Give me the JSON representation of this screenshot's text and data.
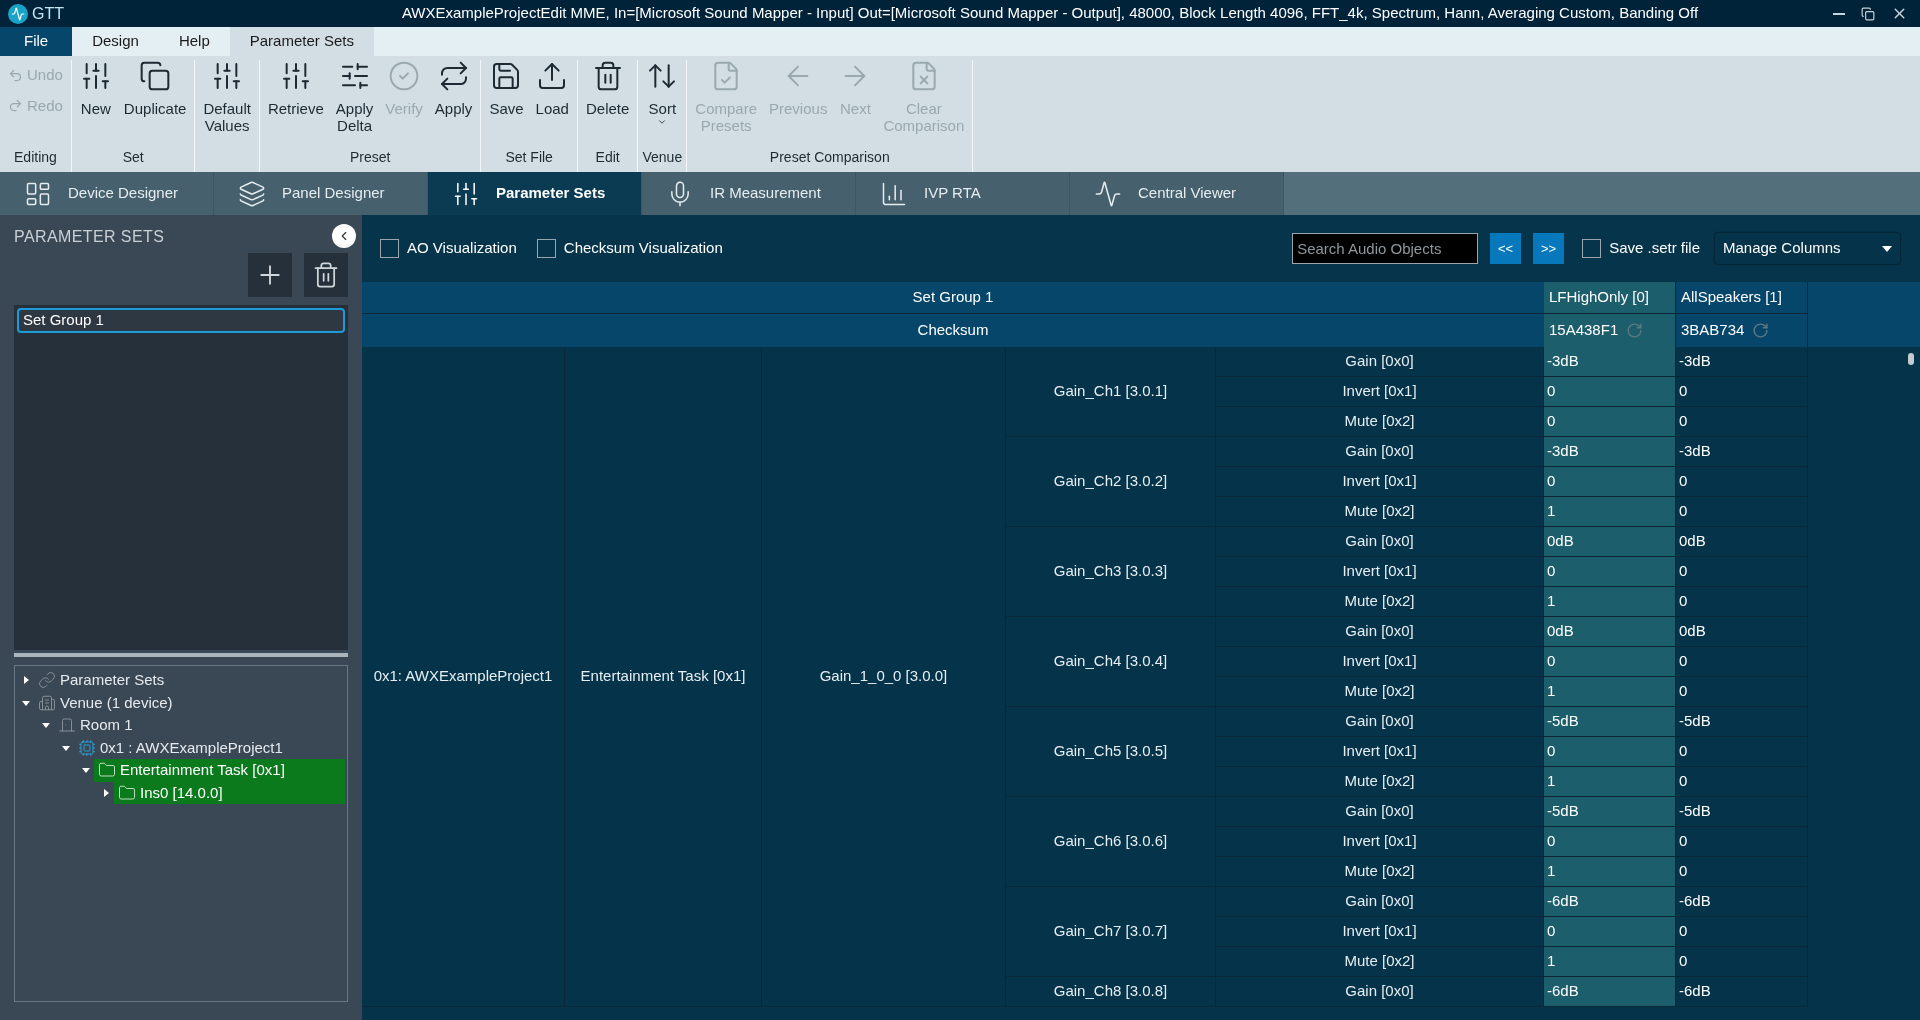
{
  "window": {
    "app_name": "GTT",
    "title": "AWXExampleProjectEdit MME, In=[Microsoft Sound Mapper - Input] Out=[Microsoft Sound Mapper - Output], 48000, Block Length 4096, FFT_4k, Spectrum, Hann, Averaging Custom, Banding Off"
  },
  "menu_tabs": [
    {
      "label": "File",
      "kind": "file",
      "selected": false
    },
    {
      "label": "Design",
      "kind": "tab",
      "selected": false
    },
    {
      "label": "Help",
      "kind": "tab",
      "selected": false
    },
    {
      "label": "Parameter Sets",
      "kind": "tab",
      "selected": true
    }
  ],
  "ribbon_groups": [
    {
      "label": "Editing",
      "kind": "small",
      "items": [
        {
          "label": "Undo",
          "disabled": true
        },
        {
          "label": "Redo",
          "disabled": true
        }
      ]
    },
    {
      "label": "Set",
      "kind": "large",
      "items": [
        {
          "label": "New",
          "disabled": false
        },
        {
          "label": "Duplicate",
          "disabled": false
        }
      ]
    },
    {
      "kind": "large",
      "items": [
        {
          "label": "Default\nValues",
          "disabled": false
        }
      ]
    },
    {
      "label": "Preset",
      "kind": "large",
      "items": [
        {
          "label": "Retrieve",
          "disabled": false
        },
        {
          "label": "Apply\nDelta",
          "disabled": false
        },
        {
          "label": "Verify",
          "disabled": true
        },
        {
          "label": "Apply",
          "disabled": false
        }
      ]
    },
    {
      "label": "Set File",
      "kind": "large",
      "items": [
        {
          "label": "Save",
          "disabled": false
        },
        {
          "label": "Load",
          "disabled": false
        }
      ]
    },
    {
      "label": "Edit",
      "kind": "large",
      "items": [
        {
          "label": "Delete",
          "disabled": false
        }
      ]
    },
    {
      "label": "Venue",
      "kind": "large",
      "items": [
        {
          "label": "Sort",
          "disabled": false,
          "menu": true
        }
      ]
    },
    {
      "label": "Preset Comparison",
      "kind": "large",
      "items": [
        {
          "label": "Compare\nPresets",
          "disabled": true
        },
        {
          "label": "Previous",
          "disabled": true
        },
        {
          "label": "Next",
          "disabled": true
        },
        {
          "label": "Clear\nComparison",
          "disabled": true
        }
      ]
    }
  ],
  "module_tabs": [
    {
      "label": "Device Designer",
      "selected": false
    },
    {
      "label": "Panel Designer",
      "selected": false
    },
    {
      "label": "Parameter Sets",
      "selected": true
    },
    {
      "label": "IR Measurement",
      "selected": false
    },
    {
      "label": "IVP RTA",
      "selected": false
    },
    {
      "label": "Central Viewer",
      "selected": false
    }
  ],
  "panel": {
    "title": "PARAMETER SETS",
    "set_groups": [
      {
        "label": "Set Group 1",
        "selected": true
      }
    ],
    "tree": [
      {
        "label": "Parameter Sets",
        "kind": "link",
        "expanded": false,
        "selected": false
      },
      {
        "label": "Venue (1 device)",
        "kind": "venue",
        "expanded": true,
        "selected": false,
        "children": [
          {
            "label": "Room 1",
            "kind": "room",
            "expanded": true,
            "selected": false,
            "children": [
              {
                "label": "0x1 : AWXExampleProject1",
                "kind": "device",
                "expanded": true,
                "selected": false,
                "children": [
                  {
                    "label": "Entertainment Task [0x1]",
                    "kind": "folder",
                    "expanded": true,
                    "selected": true,
                    "children": [
                      {
                        "label": "Ins0 [14.0.0]",
                        "kind": "folder",
                        "expanded": false,
                        "selected": true
                      }
                    ]
                  }
                ]
              }
            ]
          }
        ]
      }
    ]
  },
  "toolbar": {
    "checkboxes": [
      {
        "label": "AO Visualization",
        "checked": false
      },
      {
        "label": "Checksum Visualization",
        "checked": false
      }
    ],
    "search": {
      "placeholder": "Search Audio Objects"
    },
    "nav_buttons": [
      "<<",
      ">>"
    ],
    "save_option": {
      "label": "Save .setr file",
      "checked": false
    },
    "columns_dropdown": {
      "value": "Manage Columns"
    }
  },
  "grid": {
    "group_header": "Set Group 1",
    "checksum_label": "Checksum",
    "presets": [
      {
        "name": "LFHighOnly [0]",
        "checksum": "15A438F1",
        "selected": true
      },
      {
        "name": "AllSpeakers [1]",
        "checksum": "3BAB734",
        "selected": false
      }
    ],
    "device": "0x1: AWXExampleProject1",
    "task": "Entertainment Task [0x1]",
    "object": "Gain_1_0_0 [3.0.0]",
    "channels": [
      {
        "name": "Gain_Ch1 [3.0.1]",
        "params": [
          {
            "name": "Gain [0x0]",
            "values": [
              "-3dB",
              "-3dB"
            ]
          },
          {
            "name": "Invert [0x1]",
            "values": [
              "0",
              "0"
            ]
          },
          {
            "name": "Mute [0x2]",
            "values": [
              "0",
              "0"
            ]
          }
        ]
      },
      {
        "name": "Gain_Ch2 [3.0.2]",
        "params": [
          {
            "name": "Gain [0x0]",
            "values": [
              "-3dB",
              "-3dB"
            ]
          },
          {
            "name": "Invert [0x1]",
            "values": [
              "0",
              "0"
            ]
          },
          {
            "name": "Mute [0x2]",
            "values": [
              "1",
              "0"
            ]
          }
        ]
      },
      {
        "name": "Gain_Ch3 [3.0.3]",
        "params": [
          {
            "name": "Gain [0x0]",
            "values": [
              "0dB",
              "0dB"
            ]
          },
          {
            "name": "Invert [0x1]",
            "values": [
              "0",
              "0"
            ]
          },
          {
            "name": "Mute [0x2]",
            "values": [
              "1",
              "0"
            ]
          }
        ]
      },
      {
        "name": "Gain_Ch4 [3.0.4]",
        "params": [
          {
            "name": "Gain [0x0]",
            "values": [
              "0dB",
              "0dB"
            ]
          },
          {
            "name": "Invert [0x1]",
            "values": [
              "0",
              "0"
            ]
          },
          {
            "name": "Mute [0x2]",
            "values": [
              "1",
              "0"
            ]
          }
        ]
      },
      {
        "name": "Gain_Ch5 [3.0.5]",
        "params": [
          {
            "name": "Gain [0x0]",
            "values": [
              "-5dB",
              "-5dB"
            ]
          },
          {
            "name": "Invert [0x1]",
            "values": [
              "0",
              "0"
            ]
          },
          {
            "name": "Mute [0x2]",
            "values": [
              "1",
              "0"
            ]
          }
        ]
      },
      {
        "name": "Gain_Ch6 [3.0.6]",
        "params": [
          {
            "name": "Gain [0x0]",
            "values": [
              "-5dB",
              "-5dB"
            ]
          },
          {
            "name": "Invert [0x1]",
            "values": [
              "0",
              "0"
            ]
          },
          {
            "name": "Mute [0x2]",
            "values": [
              "1",
              "0"
            ]
          }
        ]
      },
      {
        "name": "Gain_Ch7 [3.0.7]",
        "params": [
          {
            "name": "Gain [0x0]",
            "values": [
              "-6dB",
              "-6dB"
            ]
          },
          {
            "name": "Invert [0x1]",
            "values": [
              "0",
              "0"
            ]
          },
          {
            "name": "Mute [0x2]",
            "values": [
              "1",
              "0"
            ]
          }
        ]
      },
      {
        "name": "Gain_Ch8 [3.0.8]",
        "params": [
          {
            "name": "Gain [0x0]",
            "values": [
              "-6dB",
              "-6dB"
            ]
          }
        ]
      }
    ]
  }
}
